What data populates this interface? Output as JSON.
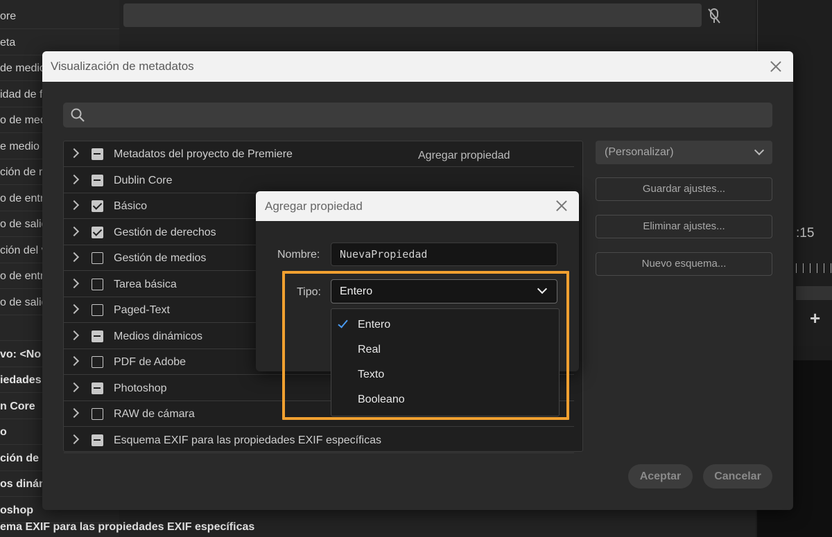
{
  "background": {
    "left_rows": [
      {
        "text": "ore",
        "bold": false
      },
      {
        "text": "eta",
        "bold": false
      },
      {
        "text": "de medio",
        "bold": false
      },
      {
        "text": "idad de f",
        "bold": false
      },
      {
        "text": "o de medi",
        "bold": false
      },
      {
        "text": "e medio",
        "bold": false
      },
      {
        "text": "ción de m",
        "bold": false
      },
      {
        "text": "o de entr",
        "bold": false
      },
      {
        "text": "o de salid",
        "bold": false
      },
      {
        "text": "ción del v",
        "bold": false
      },
      {
        "text": "o de entr",
        "bold": false
      },
      {
        "text": "o de salid",
        "bold": false
      },
      {
        "text": "",
        "bold": false
      },
      {
        "text": "vo:  <No",
        "bold": true
      },
      {
        "text": "iedades d",
        "bold": true
      },
      {
        "text": "n Core",
        "bold": true
      },
      {
        "text": "o",
        "bold": true
      },
      {
        "text": "ción de de",
        "bold": true
      },
      {
        "text": "os dinám",
        "bold": true
      },
      {
        "text": "oshop",
        "bold": true
      }
    ],
    "bottom_text": "ema EXIF para las propiedades EXIF específicas",
    "timecode": ":15",
    "plus_icon": "+"
  },
  "dialog": {
    "title": "Visualización de metadatos",
    "search_placeholder": "",
    "add_property_label": "Agregar propiedad",
    "schemas": [
      {
        "label": "Metadatos del proyecto de Premiere",
        "state": "mixed"
      },
      {
        "label": "Dublin Core",
        "state": "mixed"
      },
      {
        "label": "Básico",
        "state": "checked"
      },
      {
        "label": "Gestión de derechos",
        "state": "checked"
      },
      {
        "label": "Gestión de medios",
        "state": "unchecked"
      },
      {
        "label": " Tarea básica",
        "state": "unchecked"
      },
      {
        "label": "Paged-Text",
        "state": "unchecked"
      },
      {
        "label": "Medios dinámicos",
        "state": "mixed"
      },
      {
        "label": "PDF de Adobe",
        "state": "unchecked"
      },
      {
        "label": "Photoshop",
        "state": "mixed"
      },
      {
        "label": "RAW de cámara",
        "state": "unchecked"
      },
      {
        "label": "Esquema EXIF para las propiedades EXIF específicas",
        "state": "mixed"
      }
    ],
    "preset_select": "(Personalizar)",
    "save_settings": "Guardar ajustes...",
    "delete_settings": "Eliminar ajustes...",
    "new_schema": "Nuevo esquema...",
    "accept": "Aceptar",
    "cancel": "Cancelar"
  },
  "add_property_dialog": {
    "title": "Agregar propiedad",
    "name_label": "Nombre:",
    "name_value": "NuevaPropiedad",
    "type_label": "Tipo:",
    "type_value": "Entero",
    "type_options": [
      {
        "label": "Entero",
        "selected": true
      },
      {
        "label": "Real",
        "selected": false
      },
      {
        "label": "Texto",
        "selected": false
      },
      {
        "label": "Booleano",
        "selected": false
      }
    ]
  },
  "colors": {
    "highlight": "#f0a030",
    "check_accent": "#4a9bf2"
  }
}
